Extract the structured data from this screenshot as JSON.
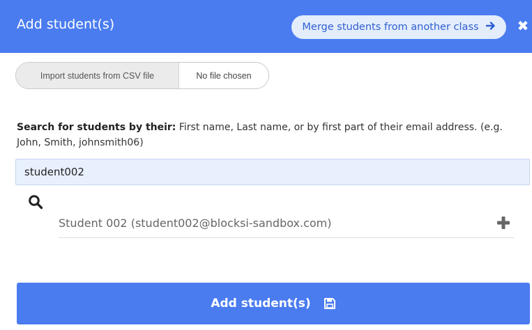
{
  "header": {
    "title": "Add student(s)",
    "merge_label": "Merge students from another class",
    "merge_icon": "arrow-right-icon",
    "close_icon": "close-icon",
    "close_glyph": "✖"
  },
  "import": {
    "button_label": "Import students from CSV file",
    "status": "No file chosen"
  },
  "search": {
    "help_bold": "Search for students by their:",
    "help_text": " First name, Last name, or by first part of their email address. (e.g. John, Smith, johnsmith06)",
    "value": "student002",
    "icon": "search-icon"
  },
  "results": [
    {
      "label": "Student 002 (student002@blocksi-sandbox.com)",
      "action_icon": "plus-icon"
    }
  ],
  "submit": {
    "label": "Add student(s)",
    "icon": "save-icon"
  },
  "colors": {
    "primary": "#4a7cf0",
    "merge_bg": "#e3edfc",
    "input_bg": "#e8f0fe"
  }
}
